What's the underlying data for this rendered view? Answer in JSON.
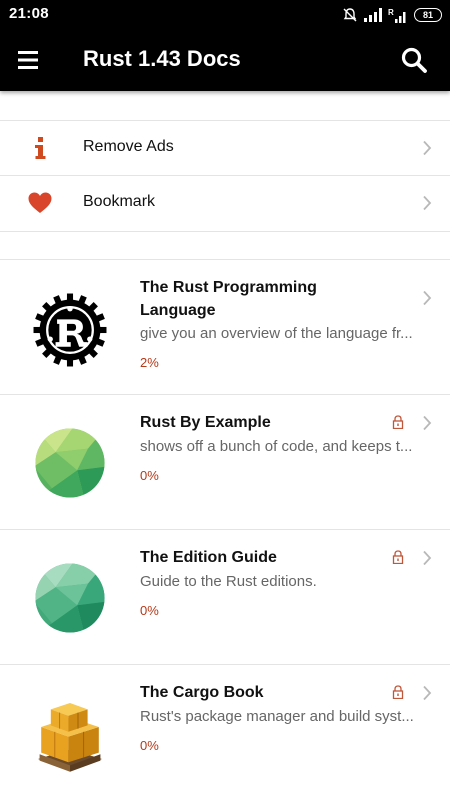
{
  "status_bar": {
    "time": "21:08",
    "battery": "81"
  },
  "app_bar": {
    "title": "Rust 1.43 Docs"
  },
  "menu": [
    {
      "label": "Remove Ads",
      "icon": "info-icon",
      "color": "#cf4a1e"
    },
    {
      "label": "Bookmark",
      "icon": "heart-icon",
      "color": "#d8452a"
    }
  ],
  "books": [
    {
      "title": "The Rust Programming Language",
      "description": "give you an overview of the language fr...",
      "progress": "2%",
      "locked": false,
      "icon": "rust-logo-icon"
    },
    {
      "title": "Rust By Example",
      "description": "shows off a bunch of code, and keeps t...",
      "progress": "0%",
      "locked": true,
      "icon": "green-sphere-icon"
    },
    {
      "title": "The Edition Guide",
      "description": "Guide to the Rust editions.",
      "progress": "0%",
      "locked": true,
      "icon": "teal-sphere-icon"
    },
    {
      "title": "The Cargo Book",
      "description": "Rust's package manager and build syst...",
      "progress": "0%",
      "locked": true,
      "icon": "cargo-boxes-icon"
    }
  ],
  "colors": {
    "accent": "#b33a1a",
    "bar": "#000000",
    "lock": "#c0563a"
  }
}
